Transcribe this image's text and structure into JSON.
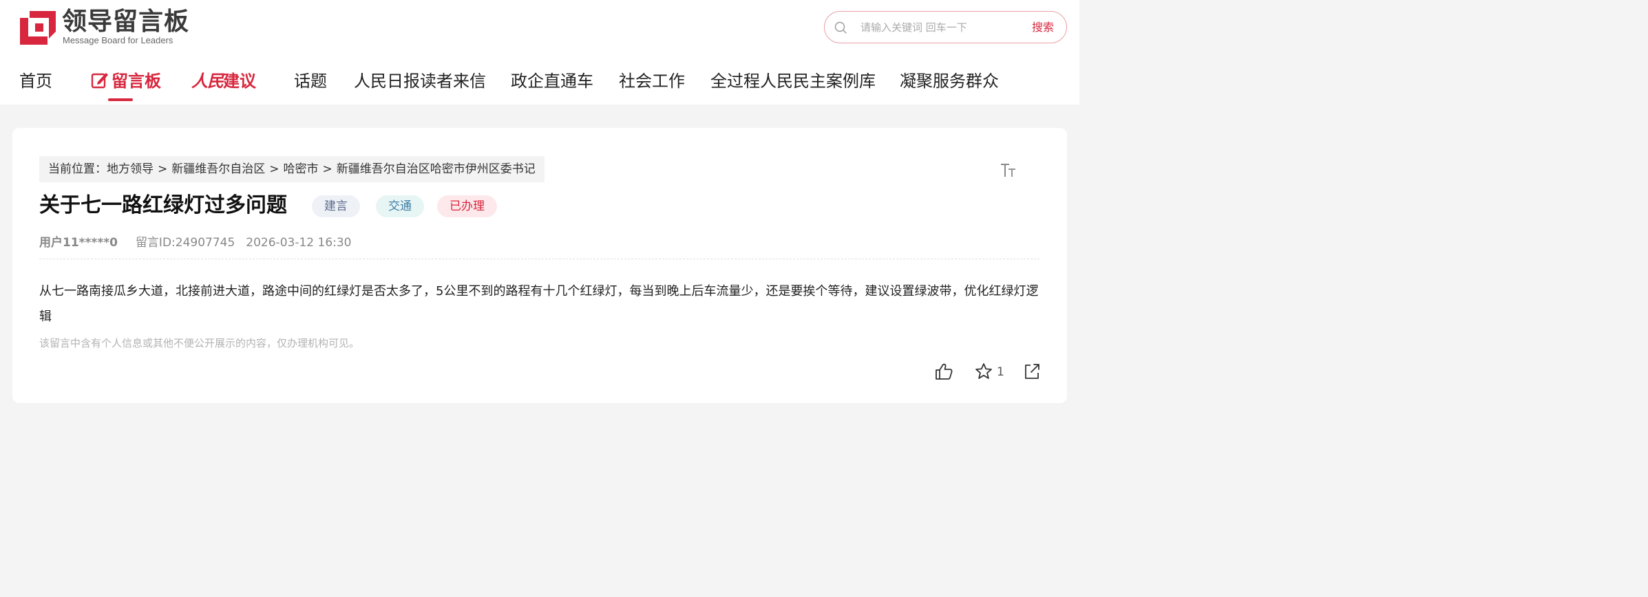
{
  "header": {
    "logo_title": "领导留言板",
    "logo_subtitle": "Message Board for Leaders",
    "search": {
      "placeholder": "请输入关键词 回车一下",
      "button_label": "搜索"
    }
  },
  "nav": {
    "items": [
      {
        "label": "首页"
      },
      {
        "label": "留言板",
        "active": true
      },
      {
        "label_a": "人民",
        "label_b": "建议"
      },
      {
        "label": "话题"
      },
      {
        "label": "人民日报读者来信"
      },
      {
        "label": "政企直通车"
      },
      {
        "label": "社会工作"
      },
      {
        "label": "全过程人民民主案例库"
      },
      {
        "label": "凝聚服务群众"
      }
    ]
  },
  "breadcrumb": {
    "prefix": "当前位置：",
    "items": [
      "地方领导",
      "新疆维吾尔自治区",
      "哈密市",
      "新疆维吾尔自治区哈密市伊州区委书记"
    ],
    "separator": ">"
  },
  "post": {
    "title": "关于七一路红绿灯过多问题",
    "tags": [
      "建言",
      "交通",
      "已办理"
    ],
    "user": "用户11*****0",
    "message_id": "留言ID:24907745",
    "datetime": "2026-03-12 16:30",
    "content": "从七一路南接瓜乡大道，北接前进大道，路途中间的红绿灯是否太多了，5公里不到的路程有十几个红绿灯，每当到晚上后车流量少，还是要挨个等待，建议设置绿波带，优化红绿灯逻辑",
    "notice": "该留言中含有个人信息或其他不便公开展示的内容，仅办理机构可见。",
    "favorite_count": "1"
  },
  "colors": {
    "brand_red": "#d7263d",
    "tag_done_bg": "#fde9eb"
  }
}
